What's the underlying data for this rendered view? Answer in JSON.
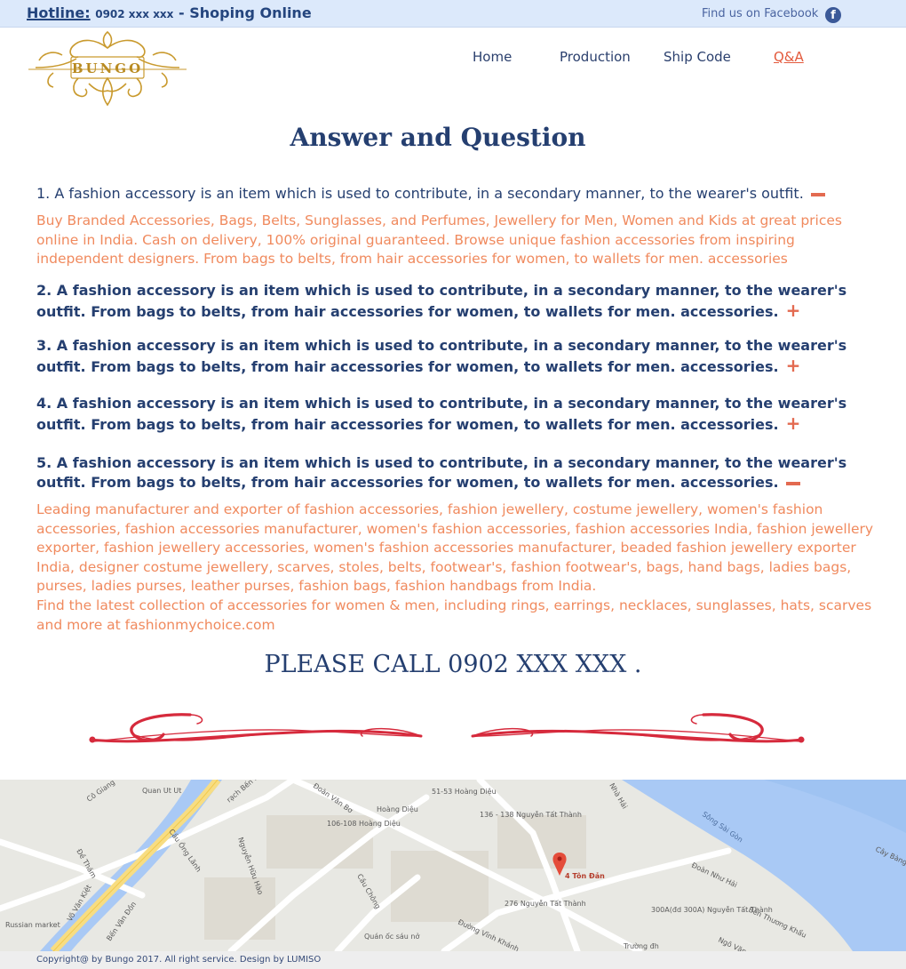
{
  "topbar": {
    "hotline_label": "Hotline:",
    "hotline_phone": "0902 xxx xxx",
    "hotline_tail": "- Shoping Online",
    "facebook_text": "Find us on Facebook",
    "facebook_glyph": "f"
  },
  "logo": {
    "text": "BUNGO"
  },
  "nav": {
    "items": [
      {
        "label": "Home"
      },
      {
        "label": "Production"
      },
      {
        "label": "Ship Code"
      },
      {
        "label": "Q&A"
      }
    ],
    "active": "Q&A"
  },
  "page_title": "Answer and Question",
  "faq": [
    {
      "question": "1. A fashion accessory is an item which is used to contribute, in a secondary manner, to the wearer's outfit.",
      "expanded": true,
      "answer": [
        "Buy Branded Accessories, Bags, Belts, Sunglasses, and Perfumes, Jewellery for Men, Women and Kids at great prices online in India. Cash on delivery, 100% original guaranteed. Browse unique fashion accessories from inspiring independent designers. From bags to belts, from hair accessories for women, to wallets for men. accessories"
      ]
    },
    {
      "question": "2. A fashion accessory is an item which is used to contribute, in a secondary manner, to the wearer's outfit. From bags to belts, from hair accessories for women, to wallets for men. accessories.",
      "expanded": false,
      "toggle": "+"
    },
    {
      "question": "3. A fashion accessory is an item which is used to contribute, in a secondary manner, to the wearer's outfit. From bags to belts, from hair accessories for women, to wallets for men. accessories.",
      "expanded": false,
      "toggle": "+"
    },
    {
      "question": "4. A fashion accessory is an item which is used to contribute, in a secondary manner, to the wearer's outfit. From bags to belts, from hair accessories for women, to wallets for men. accessories.",
      "expanded": false,
      "toggle": "+"
    },
    {
      "question": "5. A fashion accessory is an item which is used to contribute, in a secondary manner, to the wearer's outfit. From bags to belts, from hair accessories for women, to wallets for men. accessories.",
      "expanded": true,
      "answer": [
        "Leading manufacturer and exporter of fashion accessories, fashion jewellery, costume jewellery, women's fashion accessories, fashion accessories manufacturer, women's fashion accessories, fashion accessories India, fashion jewellery exporter, fashion jewellery accessories, women's fashion accessories manufacturer, beaded fashion jewellery exporter India, designer costume jewellery, scarves, stoles, belts, footwear's, fashion footwear's, bags, hand bags, ladies bags, purses, ladies purses, leather purses, fashion bags, fashion handbags from India.",
        "Find the latest collection of accessories for women & men, including rings, earrings, necklaces, sunglasses, hats, scarves and more at fashionmychoice.com"
      ]
    }
  ],
  "call_text": "PLEASE CALL 0902 XXX XXX .",
  "map": {
    "labels": {
      "quan_ut_ut": "Quan Ut Ut",
      "co_giang": "Cô Giang",
      "rach_ben_nghe": "rạch Bến Nghé",
      "doan_van_bo": "Đoàn Văn Bơ",
      "hoang_dieu": "Hoàng Diệu",
      "hoang_dieu_51": "51-53 Hoàng Diệu",
      "hoang_dieu_106": "106-108 Hoàng Diệu",
      "nguyen_tat_thanh_136": "136 - 138 Nguyễn Tất Thành",
      "nha_hai": "Nhà Hải",
      "song_sai_gon": "Sông Sài Gòn",
      "ca_long": "Cây Bàng",
      "de_tham": "Đề Thám",
      "cau_ong_lanh": "Cầu Ông Lãnh",
      "nguyen_huu_hao": "Nguyễn Hữu Hào",
      "cau_chong": "Cầu Chông",
      "ton_dan": "4 Tôn Đản",
      "nguyen_tat_thanh_276": "276 Nguyễn Tất Thành",
      "doan_nhu_hai": "Đoàn Như Hải",
      "dd_300a": "300A(đd 300A) Nguyễn Tất Thành",
      "ben_thuong_khau": "Bến Thương Khẩu",
      "vo_van_kiet": "Võ Văn Kiệt",
      "ben_van_don": "Bến Vân Đồn",
      "russian_market": "Russian market",
      "quan_oc": "Quán ốc sáu nở",
      "duong_vinh_khanh": "Đường Vĩnh Khánh",
      "truong_dh": "Trường đh",
      "ngo_van": "Ngô Văn"
    }
  },
  "footer": {
    "copyright": "Copyright@ by Bungo 2017. All right service. Design by LUMISO"
  },
  "colors": {
    "topbar_bg": "#dce9fb",
    "navy": "#253f70",
    "accent": "#e36a50",
    "answer_text": "#f08a5e",
    "gold": "#b98b22",
    "swash_red": "#d62a3c"
  }
}
